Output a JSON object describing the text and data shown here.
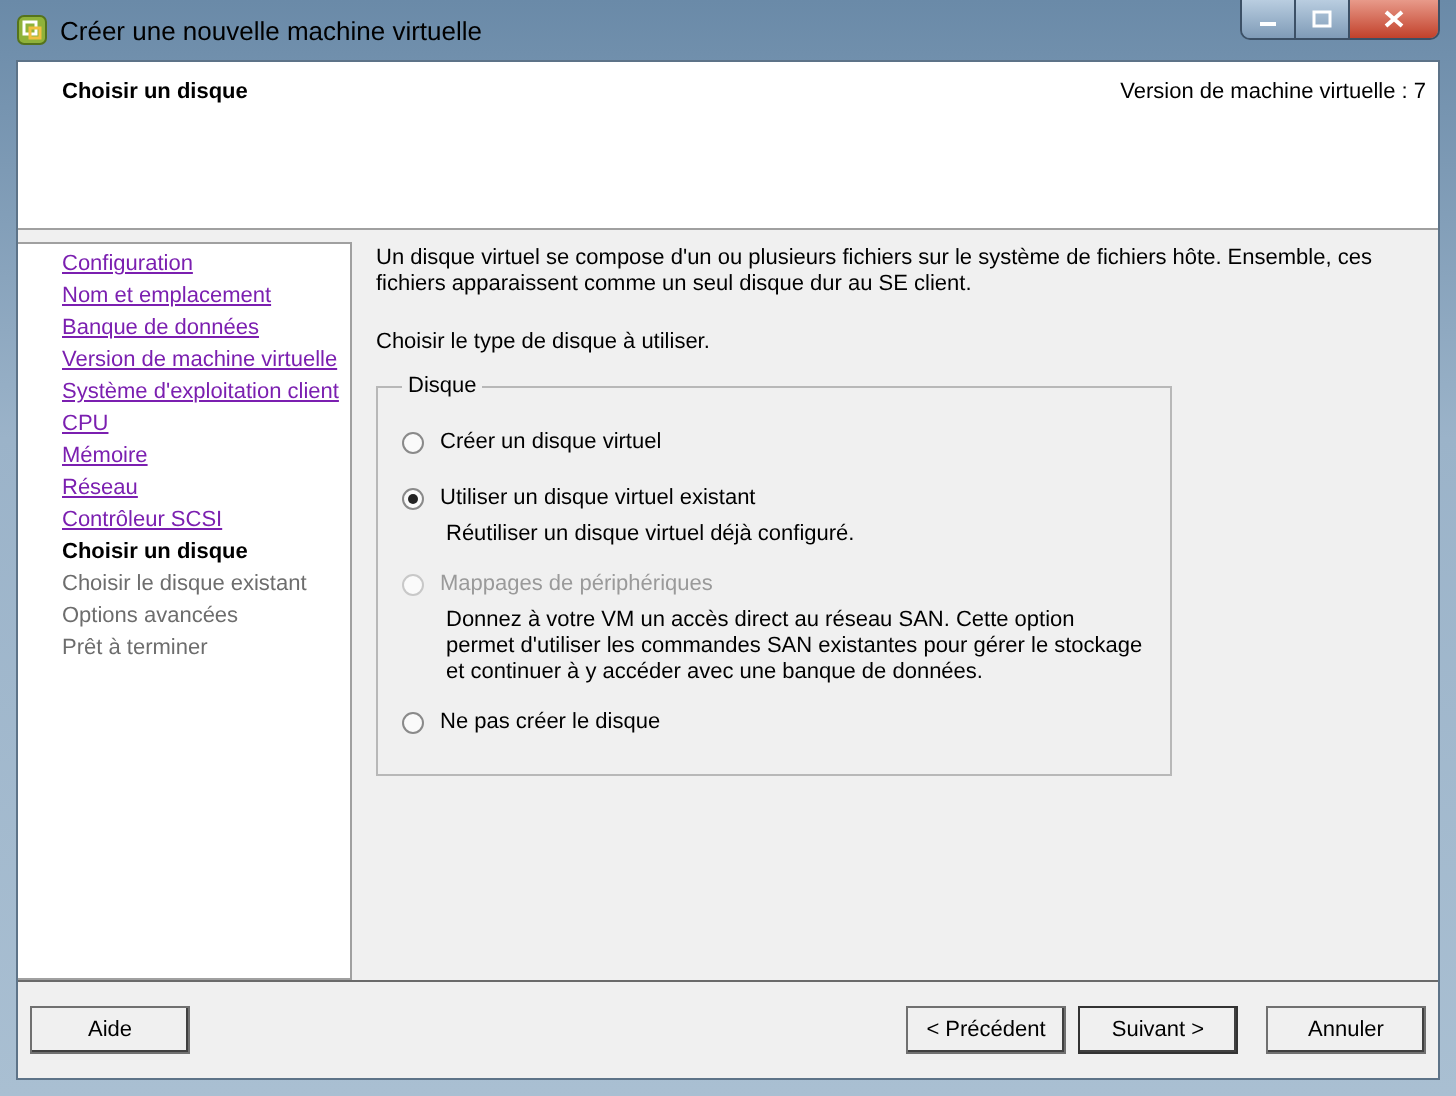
{
  "window": {
    "title": "Créer une nouvelle machine virtuelle"
  },
  "header": {
    "title": "Choisir un disque",
    "version": "Version de machine virtuelle : 7"
  },
  "steps": [
    {
      "label": "Configuration",
      "kind": "done"
    },
    {
      "label": "Nom et emplacement",
      "kind": "done"
    },
    {
      "label": "Banque de données",
      "kind": "done"
    },
    {
      "label": "Version de machine virtuelle",
      "kind": "done"
    },
    {
      "label": "Système d'exploitation client",
      "kind": "done"
    },
    {
      "label": "CPU",
      "kind": "done"
    },
    {
      "label": "Mémoire",
      "kind": "done"
    },
    {
      "label": "Réseau",
      "kind": "done"
    },
    {
      "label": "Contrôleur SCSI",
      "kind": "done"
    },
    {
      "label": "Choisir un disque",
      "kind": "current"
    },
    {
      "label": "Choisir le disque existant",
      "kind": "pending"
    },
    {
      "label": "Options avancées",
      "kind": "pending"
    },
    {
      "label": "Prêt à terminer",
      "kind": "pending"
    }
  ],
  "intro": "Un disque virtuel se compose d'un ou plusieurs fichiers sur le système de fichiers hôte. Ensemble, ces fichiers apparaissent comme un seul disque dur au SE client.",
  "prompt": "Choisir le type de disque à utiliser.",
  "group": {
    "title": "Disque",
    "options": [
      {
        "label": "Créer un disque virtuel",
        "selected": false,
        "disabled": false
      },
      {
        "label": "Utiliser un disque virtuel existant",
        "selected": true,
        "disabled": false,
        "description": "Réutiliser un disque virtuel déjà configuré."
      },
      {
        "label": "Mappages de périphériques",
        "selected": false,
        "disabled": true,
        "description": "Donnez à votre VM un accès direct au réseau SAN. Cette option permet d'utiliser les commandes SAN existantes pour gérer le stockage et continuer à y accéder avec une banque de données."
      },
      {
        "label": "Ne pas créer le disque",
        "selected": false,
        "disabled": false
      }
    ]
  },
  "buttons": {
    "help": "Aide",
    "back": "< Précédent",
    "next": "Suivant >",
    "cancel": "Annuler"
  }
}
